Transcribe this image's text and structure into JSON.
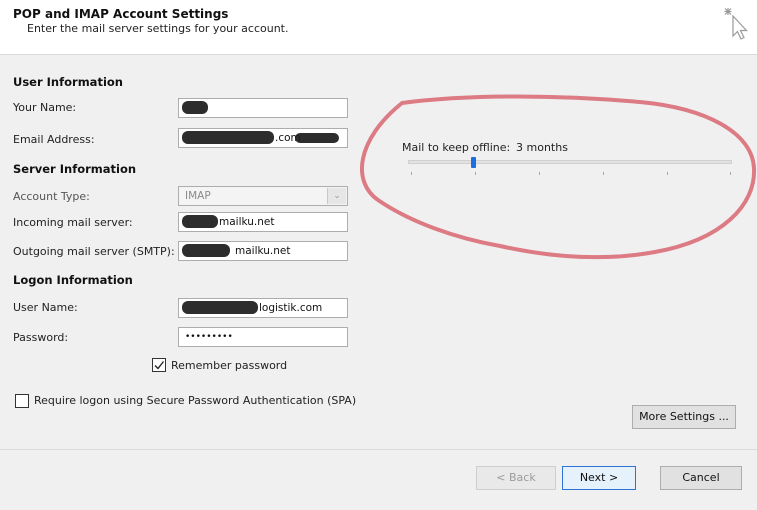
{
  "header": {
    "title": "POP and IMAP Account Settings",
    "subtitle": "Enter the mail server settings for your account."
  },
  "user_information": {
    "heading": "User Information",
    "name_label": "Your Name:",
    "email_label": "Email Address:",
    "name_value": "",
    "email_value": ".com"
  },
  "server_information": {
    "heading": "Server Information",
    "account_type_label": "Account Type:",
    "account_type_value": "IMAP",
    "incoming_label": "Incoming mail server:",
    "incoming_value": "mailku.net",
    "outgoing_label": "Outgoing mail server (SMTP):",
    "outgoing_value": "mailku.net"
  },
  "logon_information": {
    "heading": "Logon Information",
    "username_label": "User Name:",
    "username_value": "logistik.com",
    "password_label": "Password:",
    "password_value": "•••••••••",
    "remember_label": "Remember password",
    "remember_checked": true
  },
  "spa": {
    "label": "Require logon using Secure Password Authentication (SPA)",
    "checked": false
  },
  "offline": {
    "label": "Mail to keep offline:",
    "value": "3 months",
    "slider_position": 0.2
  },
  "buttons": {
    "more_settings": "More Settings ...",
    "back": "< Back",
    "next": "Next >",
    "cancel": "Cancel"
  },
  "colors": {
    "annotation": "#dc7b84",
    "slider_thumb": "#1d6fe0",
    "primary_border": "#2b74d6"
  }
}
